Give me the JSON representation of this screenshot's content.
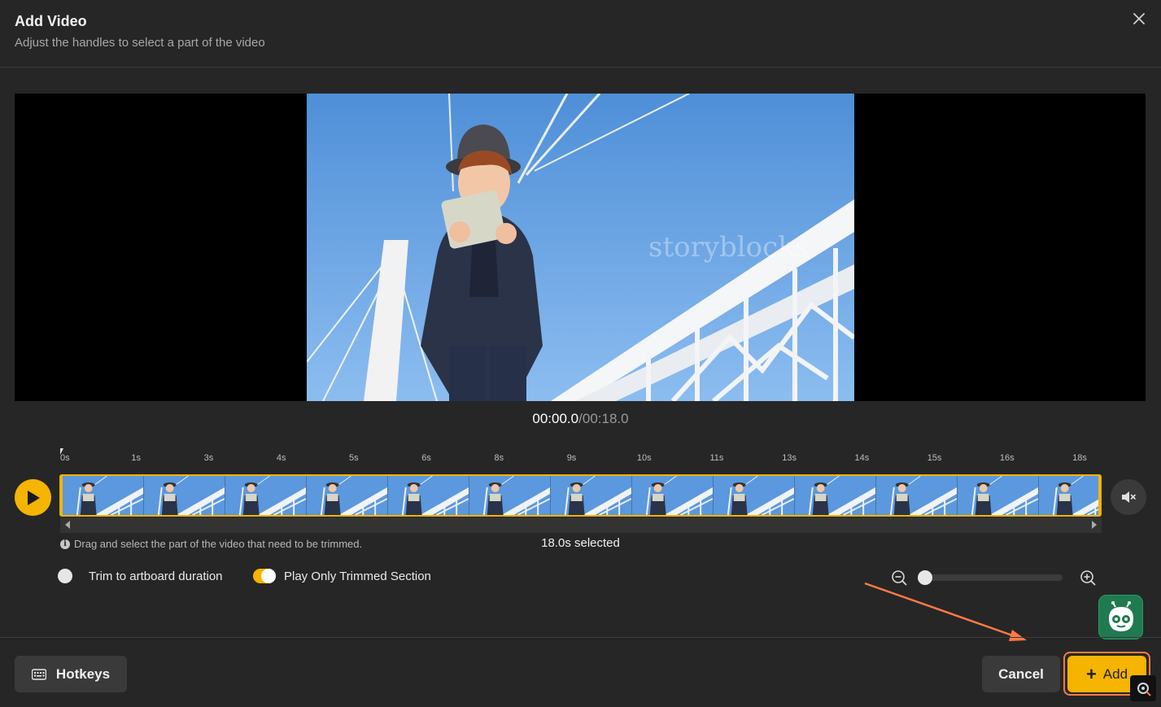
{
  "header": {
    "title": "Add Video",
    "subtitle": "Adjust the handles to select a part of the video"
  },
  "player": {
    "current_time": "00:00.0",
    "separator": "/",
    "total_time": "00:18.0",
    "watermark": "storyblocks"
  },
  "timeline": {
    "ticks": [
      "0s",
      "1s",
      "3s",
      "4s",
      "5s",
      "6s",
      "8s",
      "9s",
      "10s",
      "11s",
      "13s",
      "14s",
      "15s",
      "16s",
      "18s"
    ],
    "hint": "Drag and select the part of the video that need to be trimmed.",
    "selected_label": "18.0s selected",
    "frame_count": 13
  },
  "options": {
    "trim_label": "Trim to artboard duration",
    "trim_enabled": false,
    "play_trimmed_label": "Play Only Trimmed Section",
    "play_trimmed_enabled": true
  },
  "zoom": {
    "level": 0
  },
  "footer": {
    "hotkeys_label": "Hotkeys",
    "cancel_label": "Cancel",
    "add_label": "Add"
  },
  "colors": {
    "accent": "#f5b400",
    "annotation": "#ff7a45",
    "background": "#262626"
  }
}
